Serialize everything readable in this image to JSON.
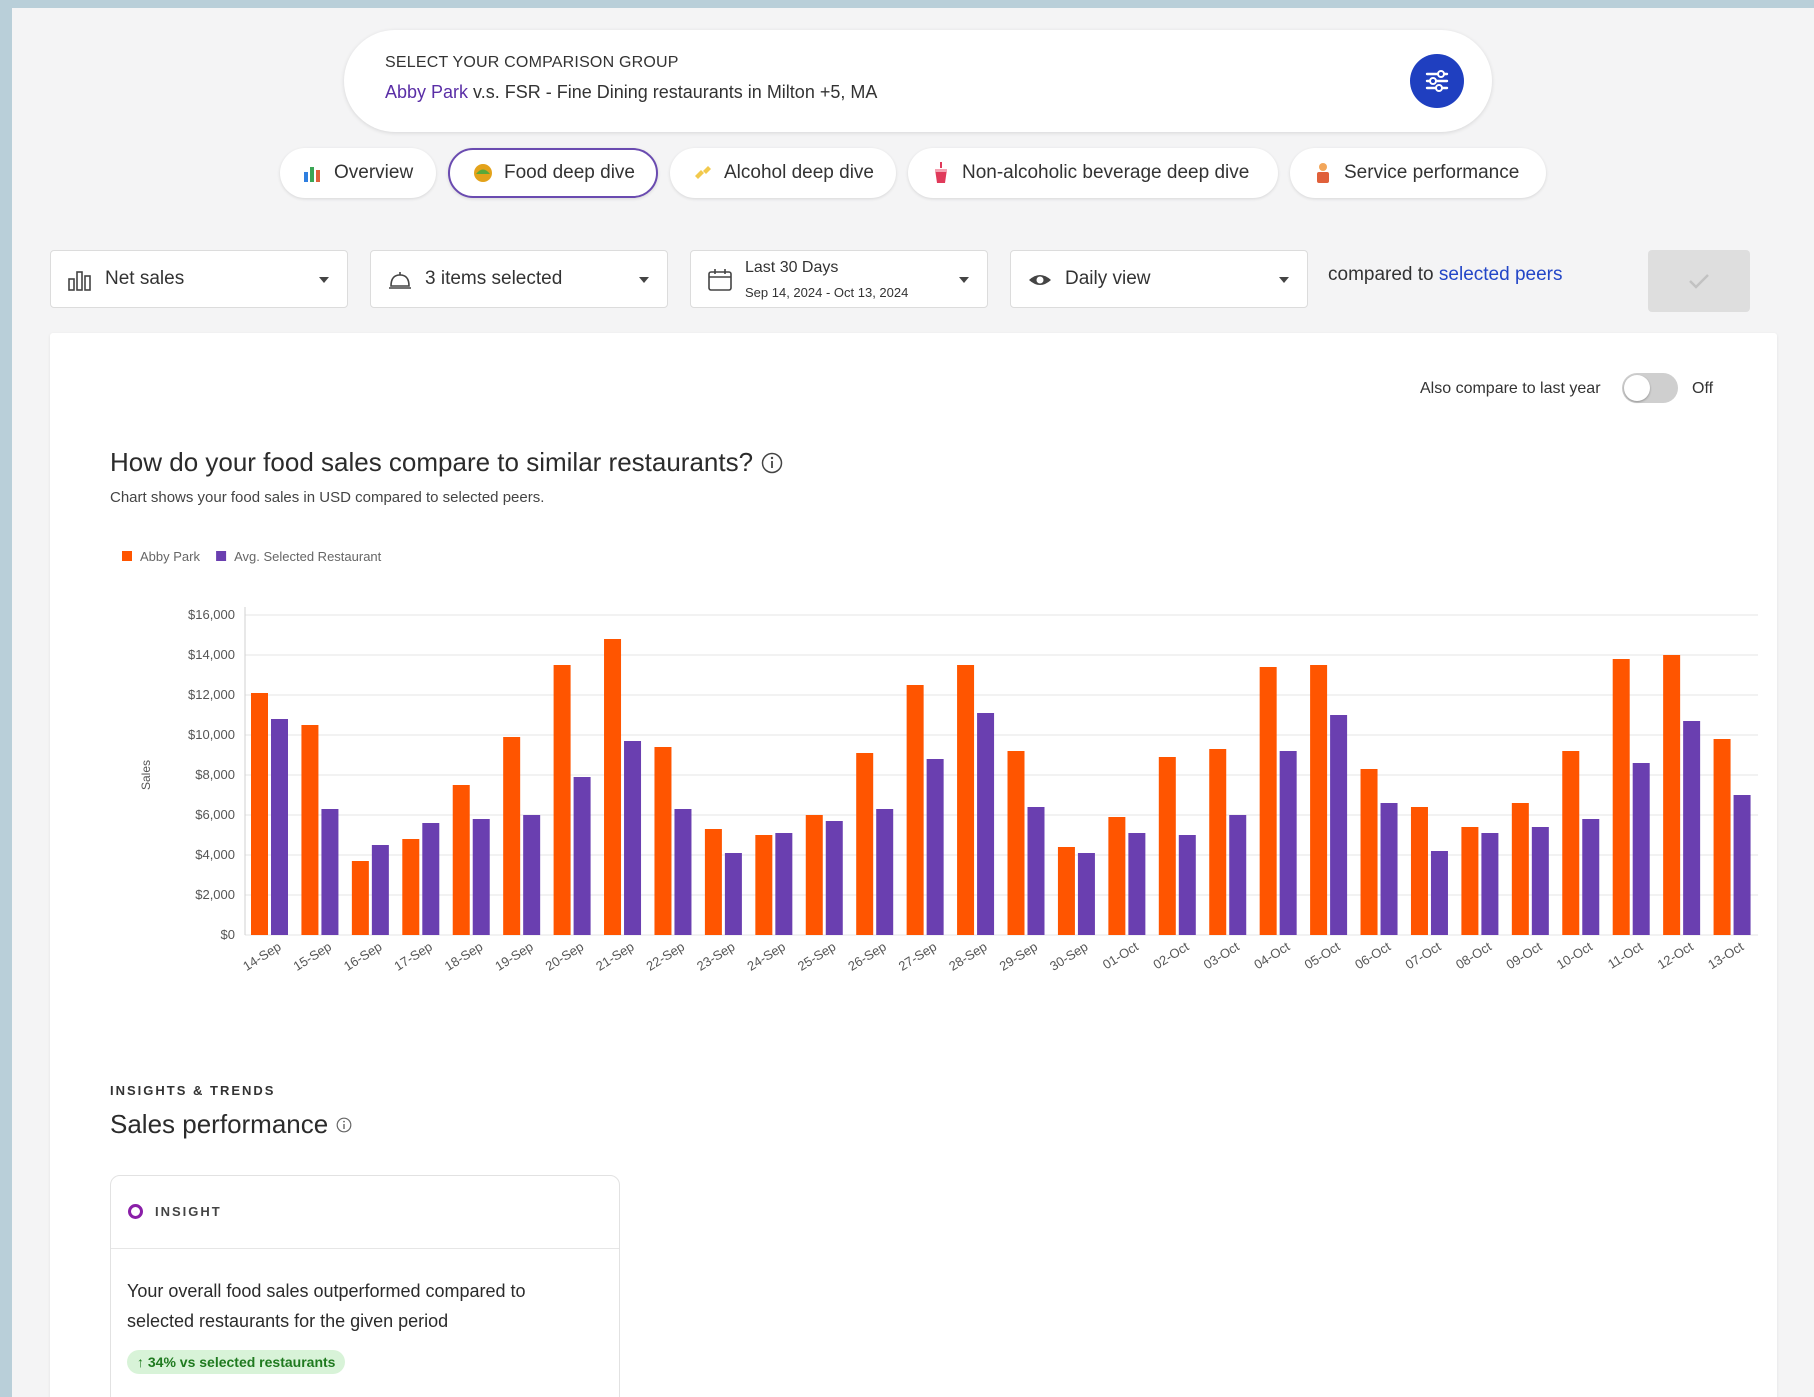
{
  "comparison": {
    "label": "SELECT YOUR COMPARISON GROUP",
    "restaurant": "Abby Park",
    "rest_text": " v.s. FSR - Fine Dining restaurants in Milton +5, MA"
  },
  "tabs": [
    {
      "label": "Overview",
      "icon": "bar-chart-icon",
      "active": false
    },
    {
      "label": "Food deep dive",
      "icon": "taco-icon",
      "active": true
    },
    {
      "label": "Alcohol deep dive",
      "icon": "cheers-icon",
      "active": false
    },
    {
      "label": "Non-alcoholic beverage deep dive",
      "icon": "soda-cup-icon",
      "active": false
    },
    {
      "label": "Service performance",
      "icon": "server-icon",
      "active": false
    }
  ],
  "filters": {
    "metric": "Net sales",
    "items": "3 items selected",
    "date_range_label": "Last 30 Days",
    "date_range_value": "Sep 14, 2024 - Oct 13, 2024",
    "view": "Daily view",
    "compared_prefix": "compared to ",
    "compared_link": "selected peers"
  },
  "toggle": {
    "label": "Also compare to last year",
    "state": "Off"
  },
  "chart": {
    "title": "How do your food sales compare to similar restaurants?",
    "subtitle": "Chart shows your food sales in USD compared to selected peers."
  },
  "chart_data": {
    "type": "bar",
    "ylabel": "Sales",
    "xlabel": "",
    "ylim": [
      0,
      16000
    ],
    "yticks": [
      0,
      2000,
      4000,
      6000,
      8000,
      10000,
      12000,
      14000,
      16000
    ],
    "ytick_labels": [
      "$0",
      "$2,000",
      "$4,000",
      "$6,000",
      "$8,000",
      "$10,000",
      "$12,000",
      "$14,000",
      "$16,000"
    ],
    "grid": true,
    "legend_position": "top-left",
    "categories": [
      "14-Sep",
      "15-Sep",
      "16-Sep",
      "17-Sep",
      "18-Sep",
      "19-Sep",
      "20-Sep",
      "21-Sep",
      "22-Sep",
      "23-Sep",
      "24-Sep",
      "25-Sep",
      "26-Sep",
      "27-Sep",
      "28-Sep",
      "29-Sep",
      "30-Sep",
      "01-Oct",
      "02-Oct",
      "03-Oct",
      "04-Oct",
      "05-Oct",
      "06-Oct",
      "07-Oct",
      "08-Oct",
      "09-Oct",
      "10-Oct",
      "11-Oct",
      "12-Oct",
      "13-Oct"
    ],
    "series": [
      {
        "name": "Abby Park",
        "color": "#ff5500",
        "values": [
          12100,
          10500,
          3700,
          4800,
          7500,
          9900,
          13500,
          14800,
          9400,
          5300,
          5000,
          6000,
          9100,
          12500,
          13500,
          9200,
          4400,
          5900,
          8900,
          9300,
          13400,
          13500,
          8300,
          6400,
          5400,
          6600,
          9200,
          13800,
          14000,
          9800
        ]
      },
      {
        "name": "Avg. Selected Restaurant",
        "color": "#6a3fb0",
        "values": [
          10800,
          6300,
          4500,
          5600,
          5800,
          6000,
          7900,
          9700,
          6300,
          4100,
          5100,
          5700,
          6300,
          8800,
          11100,
          6400,
          4100,
          5100,
          5000,
          6000,
          9200,
          11000,
          6600,
          4200,
          5100,
          5400,
          5800,
          8600,
          10700,
          7000
        ]
      }
    ]
  },
  "insights": {
    "section_label": "INSIGHTS & TRENDS",
    "title": "Sales performance",
    "card_tag": "INSIGHT",
    "text": "Your overall food sales outperformed compared to selected restaurants for the given period",
    "badge": "↑ 34% vs selected restaurants"
  }
}
